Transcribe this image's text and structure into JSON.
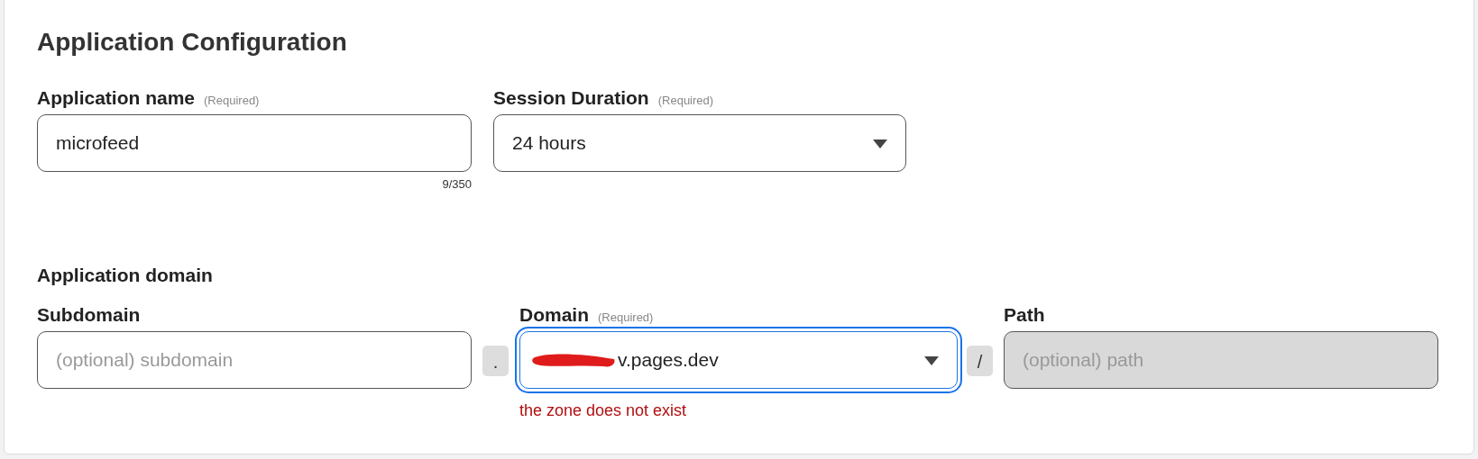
{
  "title": "Application Configuration",
  "app_name": {
    "label": "Application name",
    "hint": "(Required)",
    "value": "microfeed",
    "counter": "9/350"
  },
  "session_duration": {
    "label": "Session Duration",
    "hint": "(Required)",
    "value": "24 hours"
  },
  "domain_section": {
    "title": "Application domain",
    "subdomain": {
      "label": "Subdomain",
      "placeholder": "(optional) subdomain"
    },
    "dot_separator": ".",
    "domain": {
      "label": "Domain",
      "hint": "(Required)",
      "value": "v.pages.dev",
      "redacted": true,
      "focused": true,
      "error": "the zone does not exist"
    },
    "slash_separator": "/",
    "path": {
      "label": "Path",
      "placeholder": "(optional) path",
      "disabled": true
    }
  }
}
